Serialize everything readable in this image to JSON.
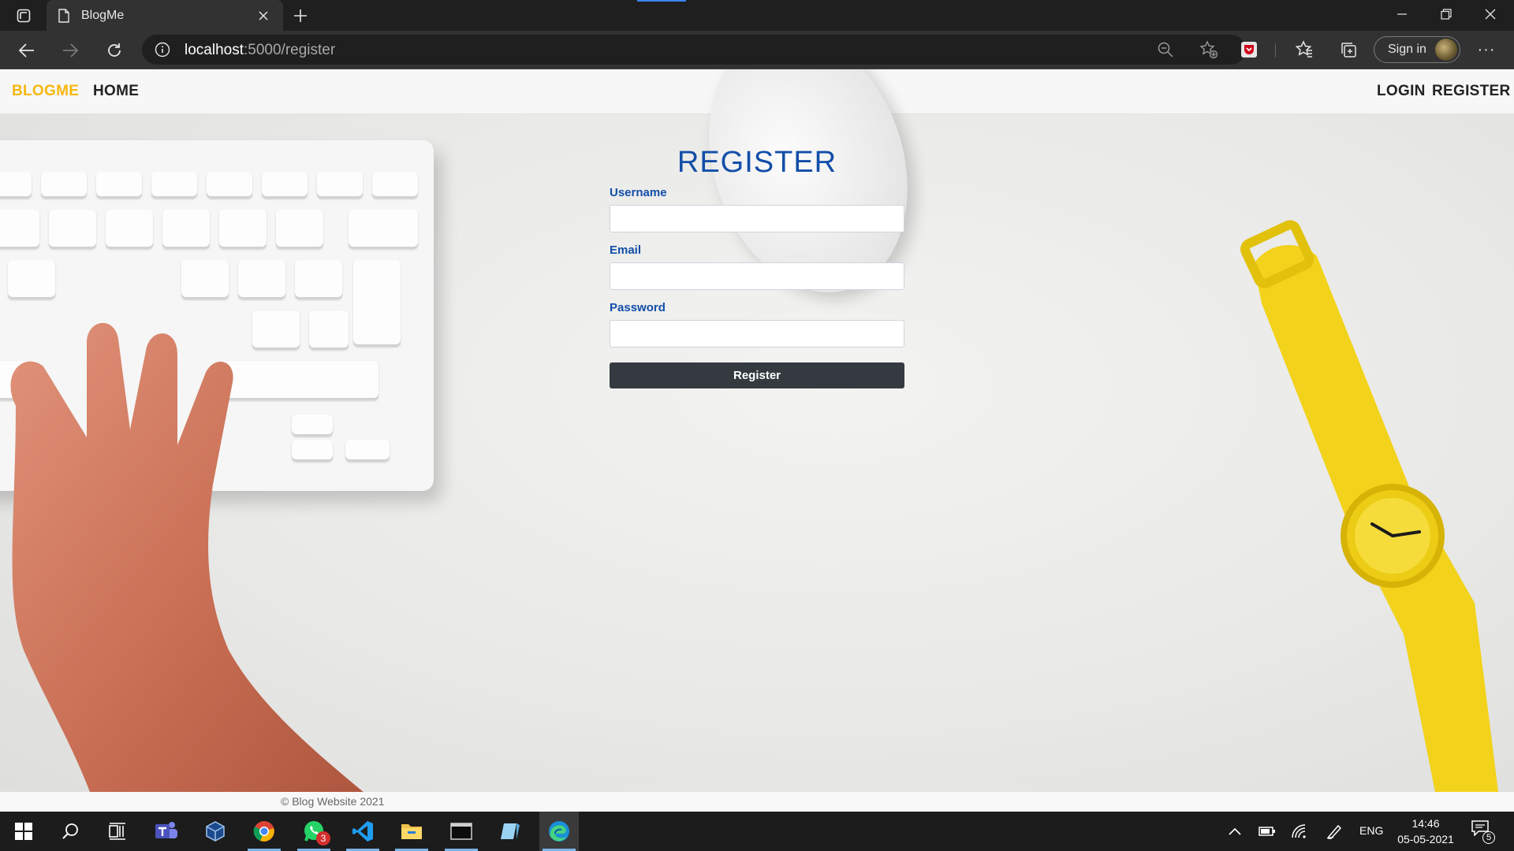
{
  "browser": {
    "tab_title": "BlogMe",
    "url_host": "localhost",
    "url_path": ":5000/register",
    "signin_label": "Sign in",
    "more_label": "···"
  },
  "site": {
    "brand": "BLOGME",
    "nav_home": "HOME",
    "nav_login": "LOGIN",
    "nav_register": "REGISTER",
    "brand_color": "#f6b80f",
    "accent_color": "#124ea8"
  },
  "form": {
    "title": "REGISTER",
    "username_label": "Username",
    "username_value": "",
    "email_label": "Email",
    "email_value": "",
    "password_label": "Password",
    "password_value": "",
    "submit_label": "Register"
  },
  "footer": {
    "text": "© Blog Website 2021"
  },
  "taskbar": {
    "apps": [
      "start-icon",
      "search-icon",
      "task-view-icon",
      "teams-icon",
      "virtualbox-icon",
      "chrome-icon",
      "whatsapp-icon",
      "vscode-icon",
      "file-explorer-icon",
      "terminal-icon",
      "notepad-icon",
      "edge-icon"
    ],
    "whatsapp_badge": "3",
    "language": "ENG",
    "time": "14:46",
    "date": "05-05-2021",
    "notification_count": "5"
  }
}
